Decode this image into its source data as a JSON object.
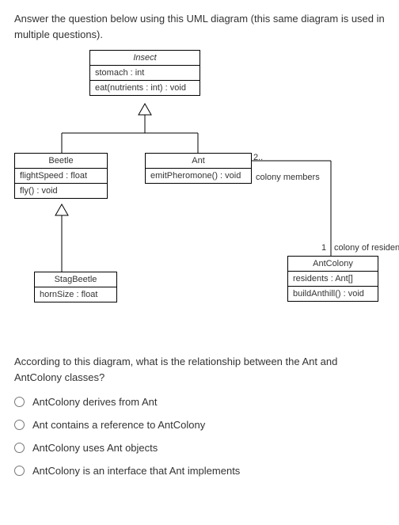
{
  "question_intro": "Answer the question below using this UML diagram (this same diagram is used in multiple questions).",
  "uml": {
    "insect": {
      "name": "Insect",
      "attr": "stomach : int",
      "op": "eat(nutrients : int) : void"
    },
    "beetle": {
      "name": "Beetle",
      "attr": "flightSpeed : float",
      "op": "fly() : void"
    },
    "ant": {
      "name": "Ant",
      "op": "emitPheromone() : void"
    },
    "stagbeetle": {
      "name": "StagBeetle",
      "attr": "hornSize : float"
    },
    "antcolony": {
      "name": "AntColony",
      "attr": "residents : Ant[]",
      "op": "buildAnthill() : void"
    },
    "assoc": {
      "ant_mult": "2..",
      "ant_role": "colony members",
      "colony_mult": "1",
      "colony_role": "colony of residence"
    }
  },
  "followup": "According to this diagram, what is the relationship between the Ant and AntColony classes?",
  "options": {
    "a": "AntColony derives from Ant",
    "b": "Ant contains a reference to AntColony",
    "c": "AntColony uses Ant objects",
    "d": "AntColony is an interface that Ant implements"
  }
}
